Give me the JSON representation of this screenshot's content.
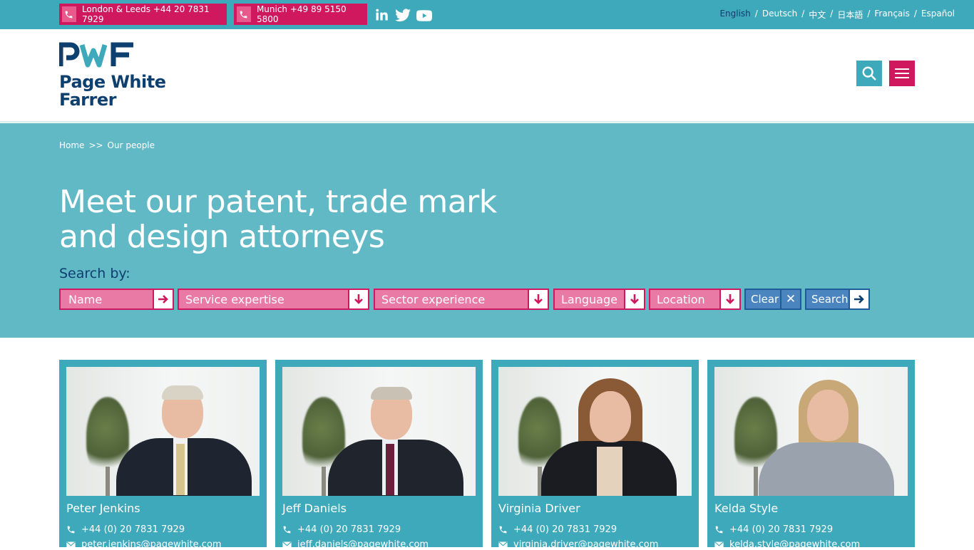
{
  "topbar": {
    "phone_london": "London & Leeds +44 20 7831 7929",
    "phone_munich": "Munich +49 89 5150 5800",
    "languages": [
      "English",
      "Deutsch",
      "中文",
      "日本語",
      "Français",
      "Español"
    ]
  },
  "header": {
    "logo_mark": "PWF",
    "logo_line1": "Page White",
    "logo_line2": "Farrer"
  },
  "breadcrumb": {
    "home": "Home",
    "separator": ">>",
    "current": "Our people"
  },
  "hero": {
    "title_line1": "Meet our patent, trade mark",
    "title_line2": "and design attorneys",
    "search_by": "Search by:"
  },
  "filters": {
    "name_placeholder": "Name",
    "service": "Service expertise",
    "sector": "Sector experience",
    "language": "Language",
    "location": "Location",
    "clear": "Clear",
    "search": "Search"
  },
  "people": [
    {
      "name": "Peter Jenkins",
      "phone": "+44 (0) 20 7831 7929",
      "email": "peter.jenkins@pagewhite.com"
    },
    {
      "name": "Jeff Daniels",
      "phone": "+44 (0) 20 7831 7929",
      "email": "jeff.daniels@pagewhite.com"
    },
    {
      "name": "Virginia Driver",
      "phone": "+44 (0) 20 7831 7929",
      "email": "virginia.driver@pagewhite.com"
    },
    {
      "name": "Kelda Style",
      "phone": "+44 (0) 20 7831 7929",
      "email": "kelda.style@pagewhite.com"
    }
  ],
  "colors": {
    "teal": "#3ea9bb",
    "hero": "#62b9c6",
    "magenta": "#d0185e",
    "navy": "#0d3f6f"
  },
  "icons": [
    "phone-icon",
    "linkedin-icon",
    "twitter-icon",
    "youtube-icon",
    "search-icon",
    "menu-icon",
    "arrow-right-icon",
    "arrow-down-icon",
    "close-icon",
    "email-icon"
  ]
}
